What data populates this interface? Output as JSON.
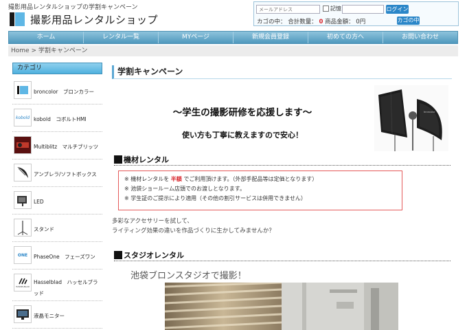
{
  "header": {
    "tagline": "撮影用品レンタルショップの学割キャンペーン",
    "logo_text": "撮影用品レンタルショップ"
  },
  "login": {
    "email_placeholder": "メールアドレス",
    "remember_label": "記憶",
    "login_button": "ログイン",
    "cart_label": "カゴの中：",
    "total_qty_label": "合計数量：",
    "total_qty_value": "0",
    "total_amount_label": "商品金額：",
    "total_amount_value": "0円",
    "cart_button": "カゴの中"
  },
  "nav": {
    "items": [
      "ホーム",
      "レンタル一覧",
      "MYページ",
      "新規会員登録",
      "初めての方へ",
      "お問い合わせ"
    ]
  },
  "breadcrumb": {
    "home": "Home",
    "separator": ">",
    "current": "学割キャンペーン"
  },
  "sidebar": {
    "header": "カテゴリ",
    "items": [
      {
        "label": "broncolor　ブロンカラー",
        "icon": "broncolor-logo-icon"
      },
      {
        "label": "kobold　コボルトHMI",
        "icon": "kobold-logo-icon"
      },
      {
        "label": "Multiblitz　マルチブリッツ",
        "icon": "multiblitz-logo-icon"
      },
      {
        "label": "アンブレラ/ソフトボックス",
        "icon": "umbrella-icon"
      },
      {
        "label": "LED",
        "icon": "led-light-icon"
      },
      {
        "label": "スタンド",
        "icon": "stand-icon"
      },
      {
        "label": "PhaseOne　フェーズワン",
        "icon": "phaseone-logo-icon"
      },
      {
        "label": "Hasselblad　ハッセルブラッド",
        "icon": "hasselblad-logo-icon"
      },
      {
        "label": "液晶モニター",
        "icon": "monitor-icon"
      }
    ],
    "logo_texts": {
      "kobold": "kobold",
      "phaseone": "ONE",
      "hasselblad": "HASSELBLAD"
    }
  },
  "main": {
    "title": "学割キャンペーン",
    "heading1": "〜学生の撮影研修を応援します〜",
    "heading2": "使い方も丁寧に教えますので安心！",
    "section1_title": "機材レンタル",
    "notice": {
      "line1_prefix": "※ 機材レンタルを ",
      "line1_highlight": "半額",
      "line1_suffix": " でご利用頂けます。（外部手配品等は定価となります）",
      "line2": "※ 池袋ショールーム店頭でのお渡しとなります。",
      "line3": "※ 学生証のご提示により適用（その他の割引サービスは併用できません）"
    },
    "body_line1": "多彩なアクセサリーを試して、",
    "body_line2": "ライティング効果の違いを作品づくりに生かしてみませんか？",
    "section2_title": "スタジオレンタル",
    "studio_caption": "池袋ブロンスタジオで撮影！",
    "softbox_brand": "broncolor"
  },
  "colors": {
    "accent_blue": "#2a86c8",
    "nav_blue": "#5ea3c7",
    "notice_red": "#e45858",
    "highlight_red": "#d8232a"
  }
}
